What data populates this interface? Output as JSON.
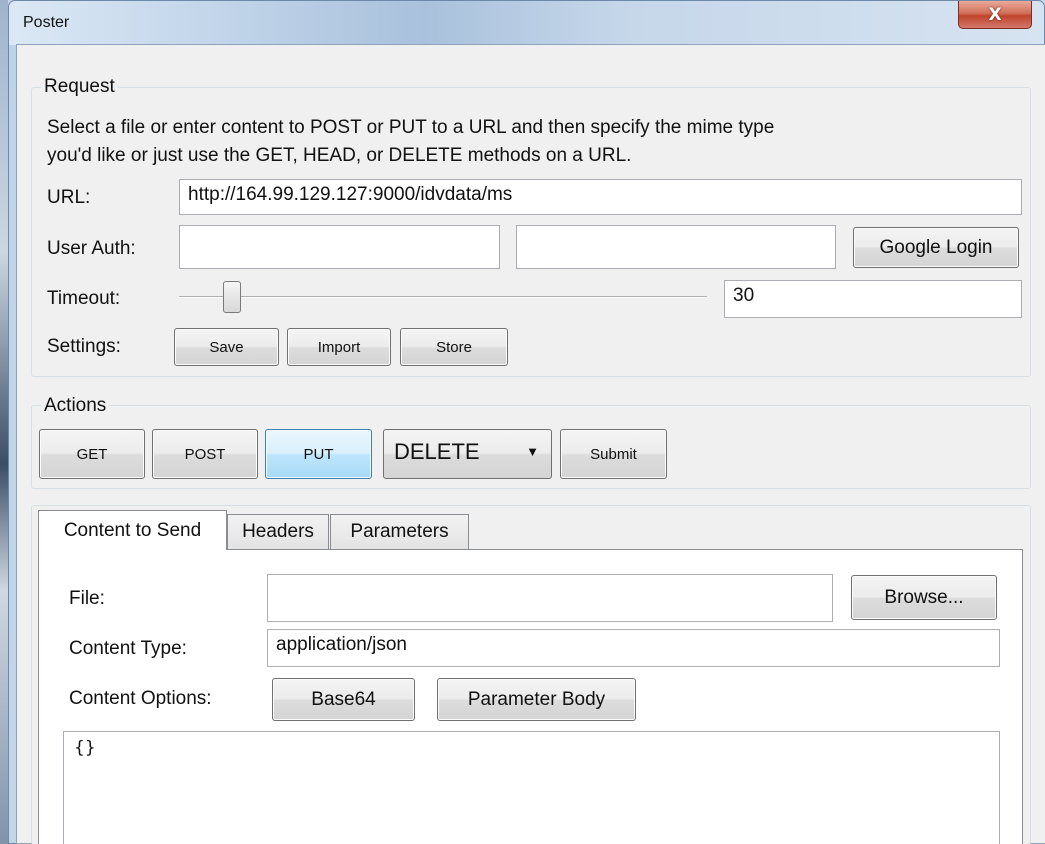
{
  "window": {
    "title": "Poster",
    "close_label": "X"
  },
  "request": {
    "legend": "Request",
    "description_line1": "Select a file or enter content to POST or PUT to a URL and then specify the mime type",
    "description_line2": "you'd like or just use the GET, HEAD, or DELETE methods on a URL.",
    "url_label": "URL:",
    "url_value": "http://164.99.129.127:9000/idvdata/ms",
    "user_auth_label": "User Auth:",
    "user_auth_username": "",
    "user_auth_password": "",
    "google_login_label": "Google Login",
    "timeout_label": "Timeout:",
    "timeout_value": "30",
    "timeout_slider_fraction": 0.1,
    "settings_label": "Settings:",
    "save_label": "Save",
    "import_label": "Import",
    "store_label": "Store"
  },
  "actions": {
    "legend": "Actions",
    "get_label": "GET",
    "post_label": "POST",
    "put_label": "PUT",
    "method_selected": "DELETE",
    "submit_label": "Submit"
  },
  "tabs": [
    {
      "label": "Content to Send",
      "active": true
    },
    {
      "label": "Headers",
      "active": false
    },
    {
      "label": "Parameters",
      "active": false
    }
  ],
  "content": {
    "file_label": "File:",
    "file_value": "",
    "browse_label": "Browse...",
    "content_type_label": "Content Type:",
    "content_type_value": "application/json",
    "content_options_label": "Content Options:",
    "base64_label": "Base64",
    "parameter_body_label": "Parameter Body",
    "body_text": "{}"
  }
}
